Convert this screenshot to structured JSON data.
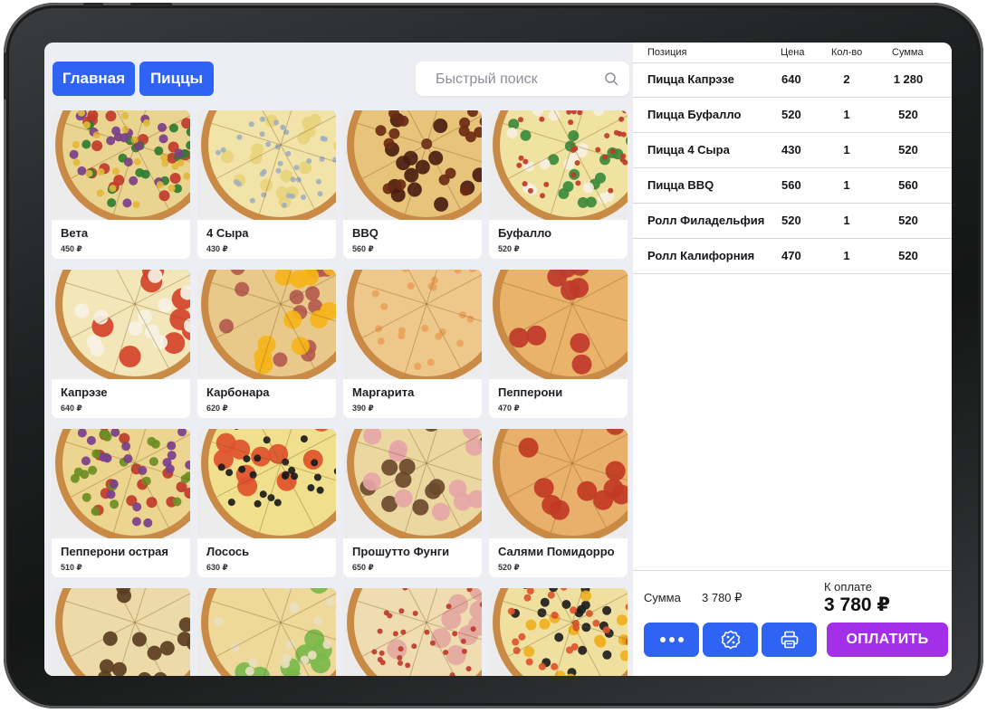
{
  "categories": {
    "home": "Главная",
    "pizzas": "Пиццы"
  },
  "search": {
    "placeholder": "Быстрый поиск"
  },
  "products": [
    {
      "name": "Вета",
      "price": "450 ₽",
      "style": "veggie"
    },
    {
      "name": "4 Сыра",
      "price": "430 ₽",
      "style": "cheese"
    },
    {
      "name": "BBQ",
      "price": "560 ₽",
      "style": "bbq"
    },
    {
      "name": "Буфалло",
      "price": "520 ₽",
      "style": "buffalo"
    },
    {
      "name": "Капрэзе",
      "price": "640 ₽",
      "style": "caprese"
    },
    {
      "name": "Карбонара",
      "price": "620 ₽",
      "style": "carbonara"
    },
    {
      "name": "Маргарита",
      "price": "390 ₽",
      "style": "margarita"
    },
    {
      "name": "Пепперони",
      "price": "470 ₽",
      "style": "pepperoni"
    },
    {
      "name": "Пепперони острая",
      "price": "510 ₽",
      "style": "spicy"
    },
    {
      "name": "Лосось",
      "price": "630 ₽",
      "style": "salmon"
    },
    {
      "name": "Прошутто Фунги",
      "price": "650 ₽",
      "style": "funghi"
    },
    {
      "name": "Салями Помидорро",
      "price": "520 ₽",
      "style": "salami"
    },
    {
      "name": "",
      "price": "",
      "style": "mushroom"
    },
    {
      "name": "",
      "price": "",
      "style": "salad"
    },
    {
      "name": "",
      "price": "",
      "style": "ham"
    },
    {
      "name": "",
      "price": "",
      "style": "olive"
    }
  ],
  "order": {
    "columns": {
      "item": "Позиция",
      "price": "Цена",
      "qty": "Кол-во",
      "sum": "Сумма"
    },
    "rows": [
      {
        "item": "Пицца Капрэзе",
        "price": "640",
        "qty": "2",
        "sum": "1 280"
      },
      {
        "item": "Пицца Буфалло",
        "price": "520",
        "qty": "1",
        "sum": "520"
      },
      {
        "item": "Пицца 4 Сыра",
        "price": "430",
        "qty": "1",
        "sum": "520"
      },
      {
        "item": "Пицца BBQ",
        "price": "560",
        "qty": "1",
        "sum": "560"
      },
      {
        "item": "Ролл Филадельфия",
        "price": "520",
        "qty": "1",
        "sum": "520"
      },
      {
        "item": "Ролл Калифорния",
        "price": "470",
        "qty": "1",
        "sum": "520"
      }
    ],
    "sum_label": "Сумма",
    "sum_value": "3 780 ₽",
    "to_pay_label": "К оплате",
    "to_pay_value": "3 780 ₽",
    "pay_button": "ОПЛАТИТЬ"
  },
  "icons": {
    "more": "more-dots-icon",
    "discount": "discount-icon",
    "print": "printer-icon",
    "search": "search-icon"
  },
  "colors": {
    "accent": "#2f63f3",
    "pay": "#a330e8",
    "panel_bg": "#eceef3"
  }
}
